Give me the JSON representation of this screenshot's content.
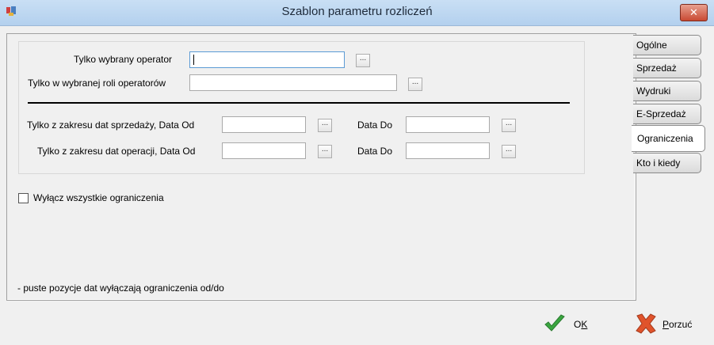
{
  "window": {
    "title": "Szablon parametru rozliczeń",
    "close_label": "✕"
  },
  "form": {
    "operator_label": "Tylko wybrany operator",
    "operator_value": "",
    "role_label": "Tylko w wybranej roli operatorów",
    "role_value": "",
    "browse_label": "...",
    "sale_date_from_label": "Tylko z zakresu dat sprzedaży, Data Od",
    "sale_date_to_label": "Data Do",
    "op_date_from_label": "Tylko z zakresu dat operacji, Data Od",
    "op_date_to_label": "Data Do",
    "disable_all_label": "Wyłącz wszystkie ograniczenia",
    "disable_all_checked": false,
    "note": "- puste pozycje dat wyłączają ograniczenia od/do"
  },
  "tabs": [
    {
      "label": "Ogólne"
    },
    {
      "label": "Sprzedaż"
    },
    {
      "label": "Wydruki"
    },
    {
      "label": "E-Sprzedaż"
    },
    {
      "label": "Ograniczenia",
      "active": true
    },
    {
      "label": "Kto i kiedy"
    }
  ],
  "buttons": {
    "ok_label_prefix": "O",
    "ok_label_accel": "K",
    "cancel_label_accel": "P",
    "cancel_label_rest": "orzuć"
  },
  "colors": {
    "ok_check": "#3aa640",
    "cancel_x": "#e0532b"
  }
}
